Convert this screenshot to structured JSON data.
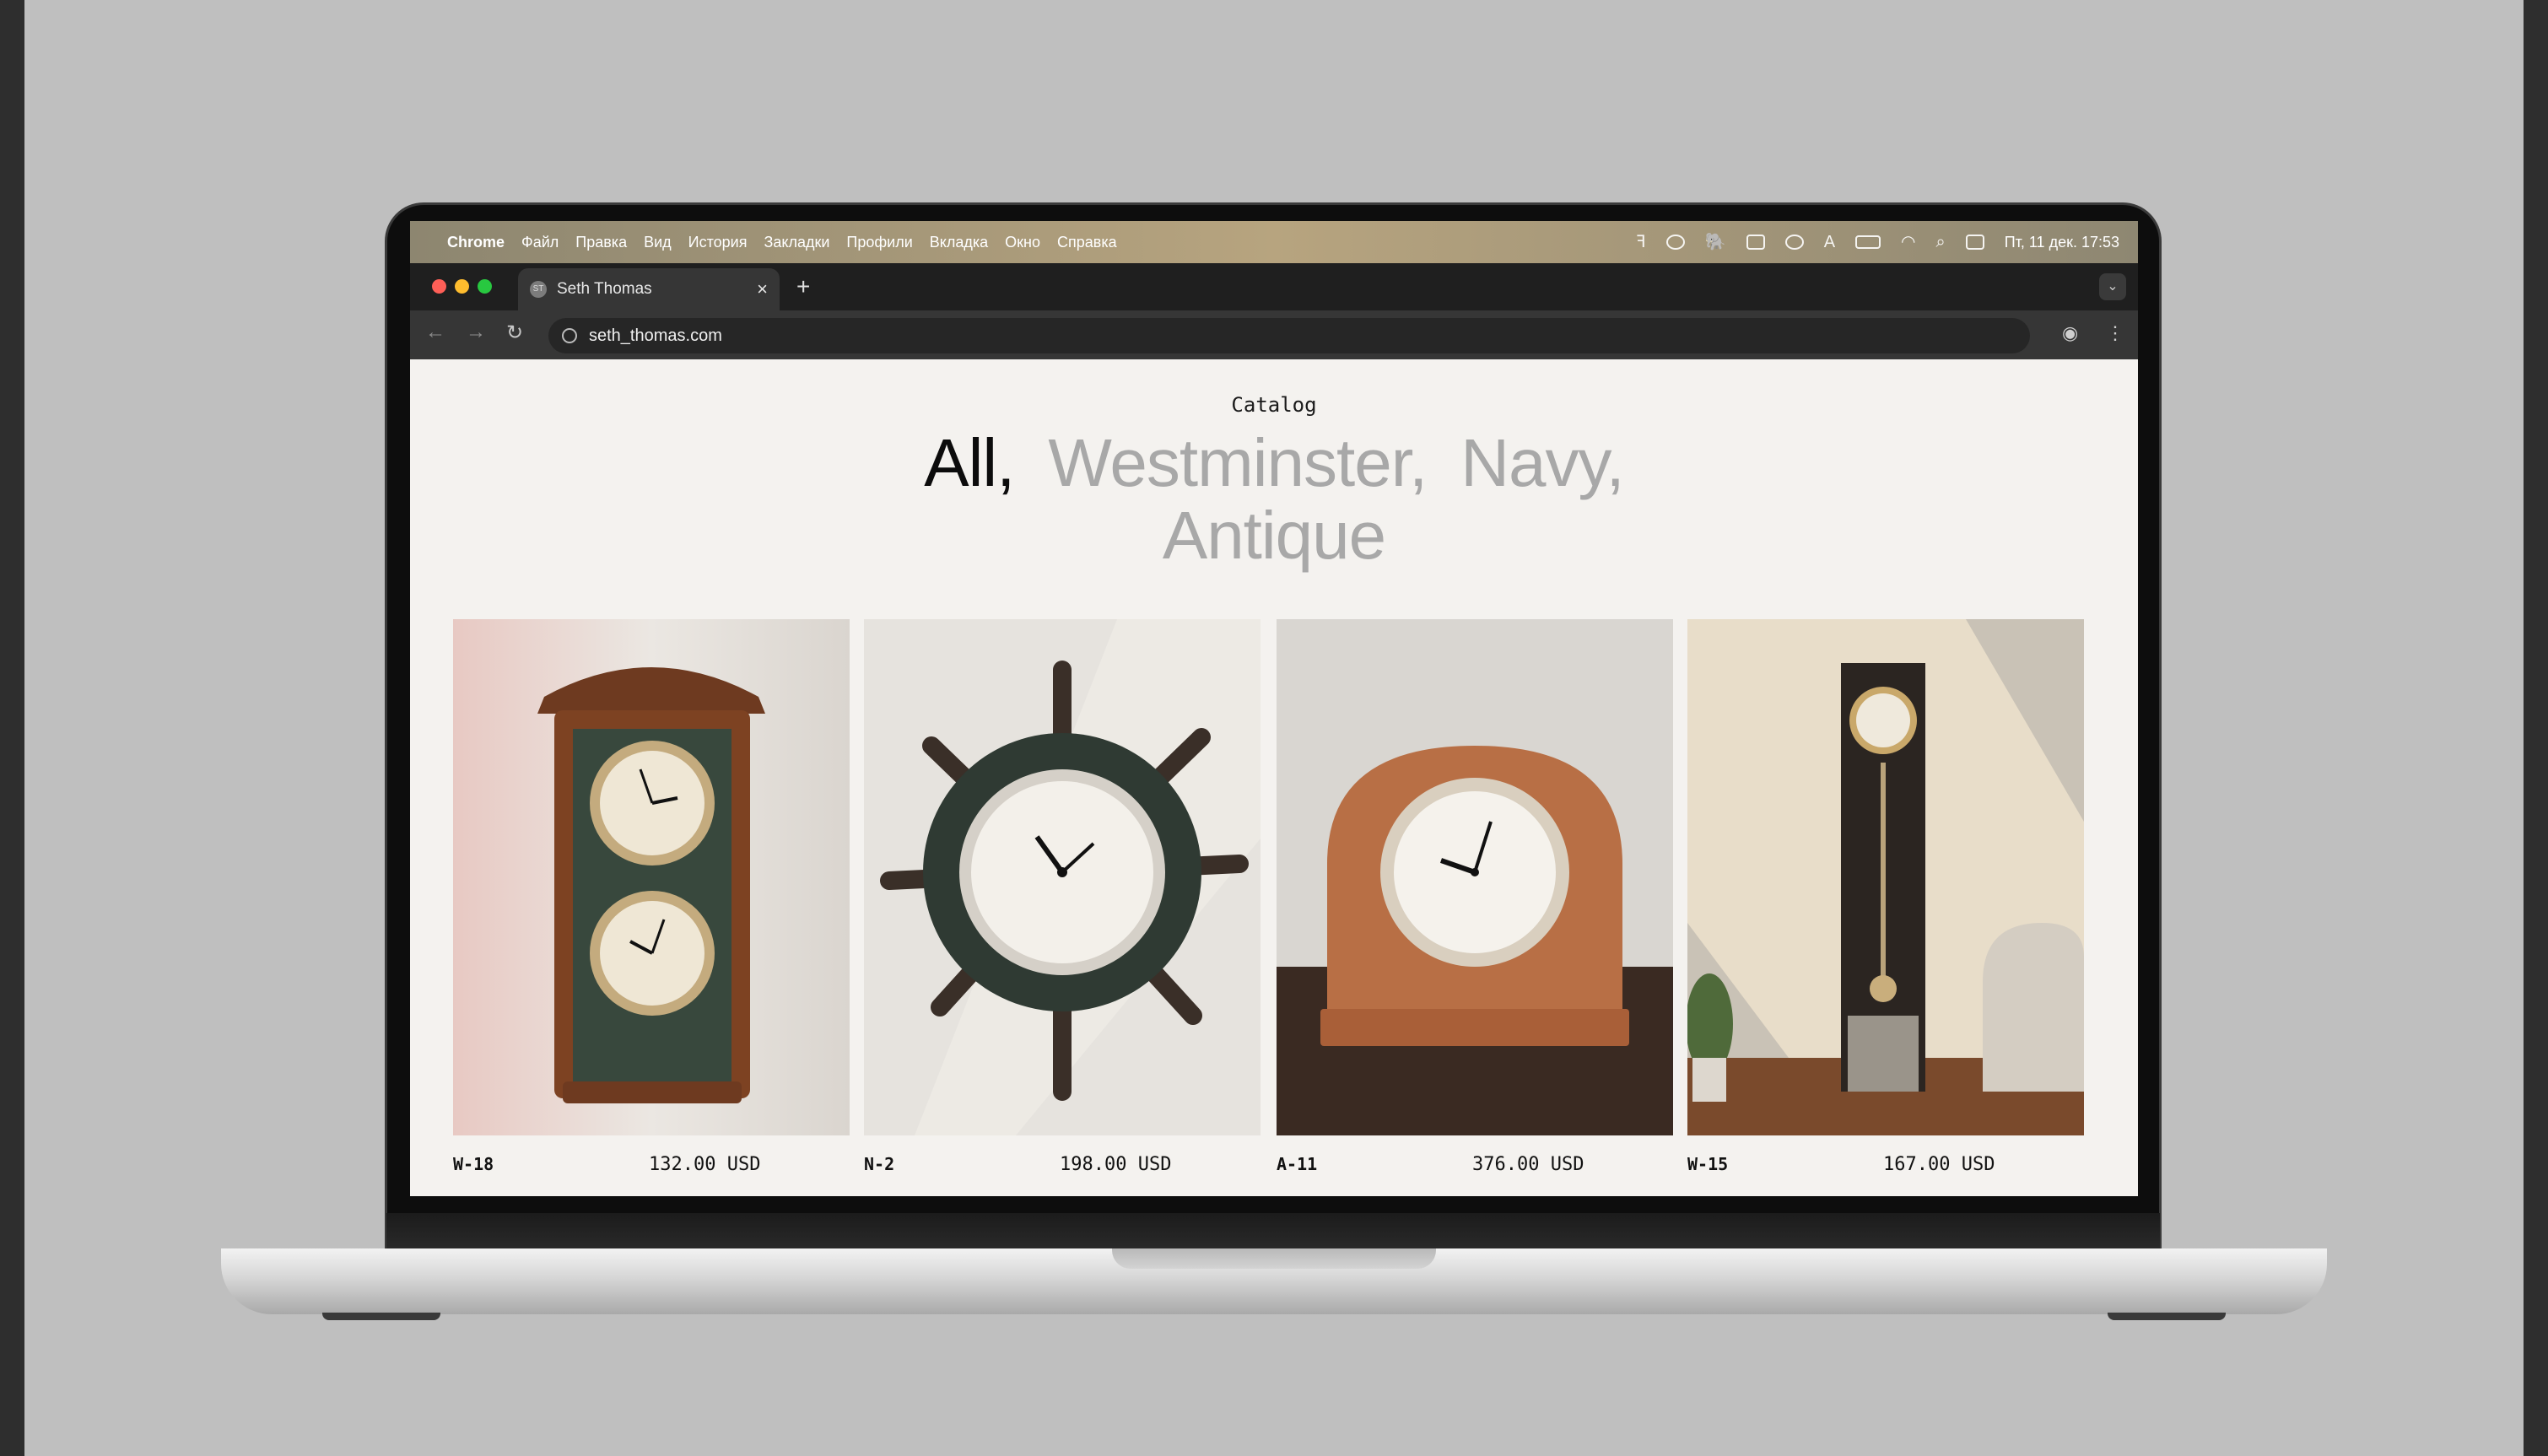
{
  "menubar": {
    "app": "Chrome",
    "items": [
      "Файл",
      "Правка",
      "Вид",
      "История",
      "Закладки",
      "Профили",
      "Вкладка",
      "Окно",
      "Справка"
    ],
    "clock": "Пт, 11 дек.  17:53"
  },
  "browser": {
    "tab_title": "Seth Thomas",
    "url": "seth_thomas.com"
  },
  "page": {
    "heading": "Catalog",
    "filters": [
      {
        "label": "All,",
        "active": true
      },
      {
        "label": "Westminster,",
        "active": false
      },
      {
        "label": "Navy,",
        "active": false
      },
      {
        "label": "Antique",
        "active": false
      }
    ],
    "products": [
      {
        "name": "W-18",
        "price": "132.00 USD",
        "image": "double-dial-wall-clock"
      },
      {
        "name": "N-2",
        "price": "198.00 USD",
        "image": "ship-wheel-clock"
      },
      {
        "name": "A-11",
        "price": "376.00 USD",
        "image": "mantel-clock"
      },
      {
        "name": "W-15",
        "price": "167.00 USD",
        "image": "pendulum-floor-clock"
      }
    ]
  },
  "colors": {
    "page_bg": "#f4f2ef",
    "filter_active": "#0c0c0c",
    "filter_inactive": "#a8a8a8"
  }
}
